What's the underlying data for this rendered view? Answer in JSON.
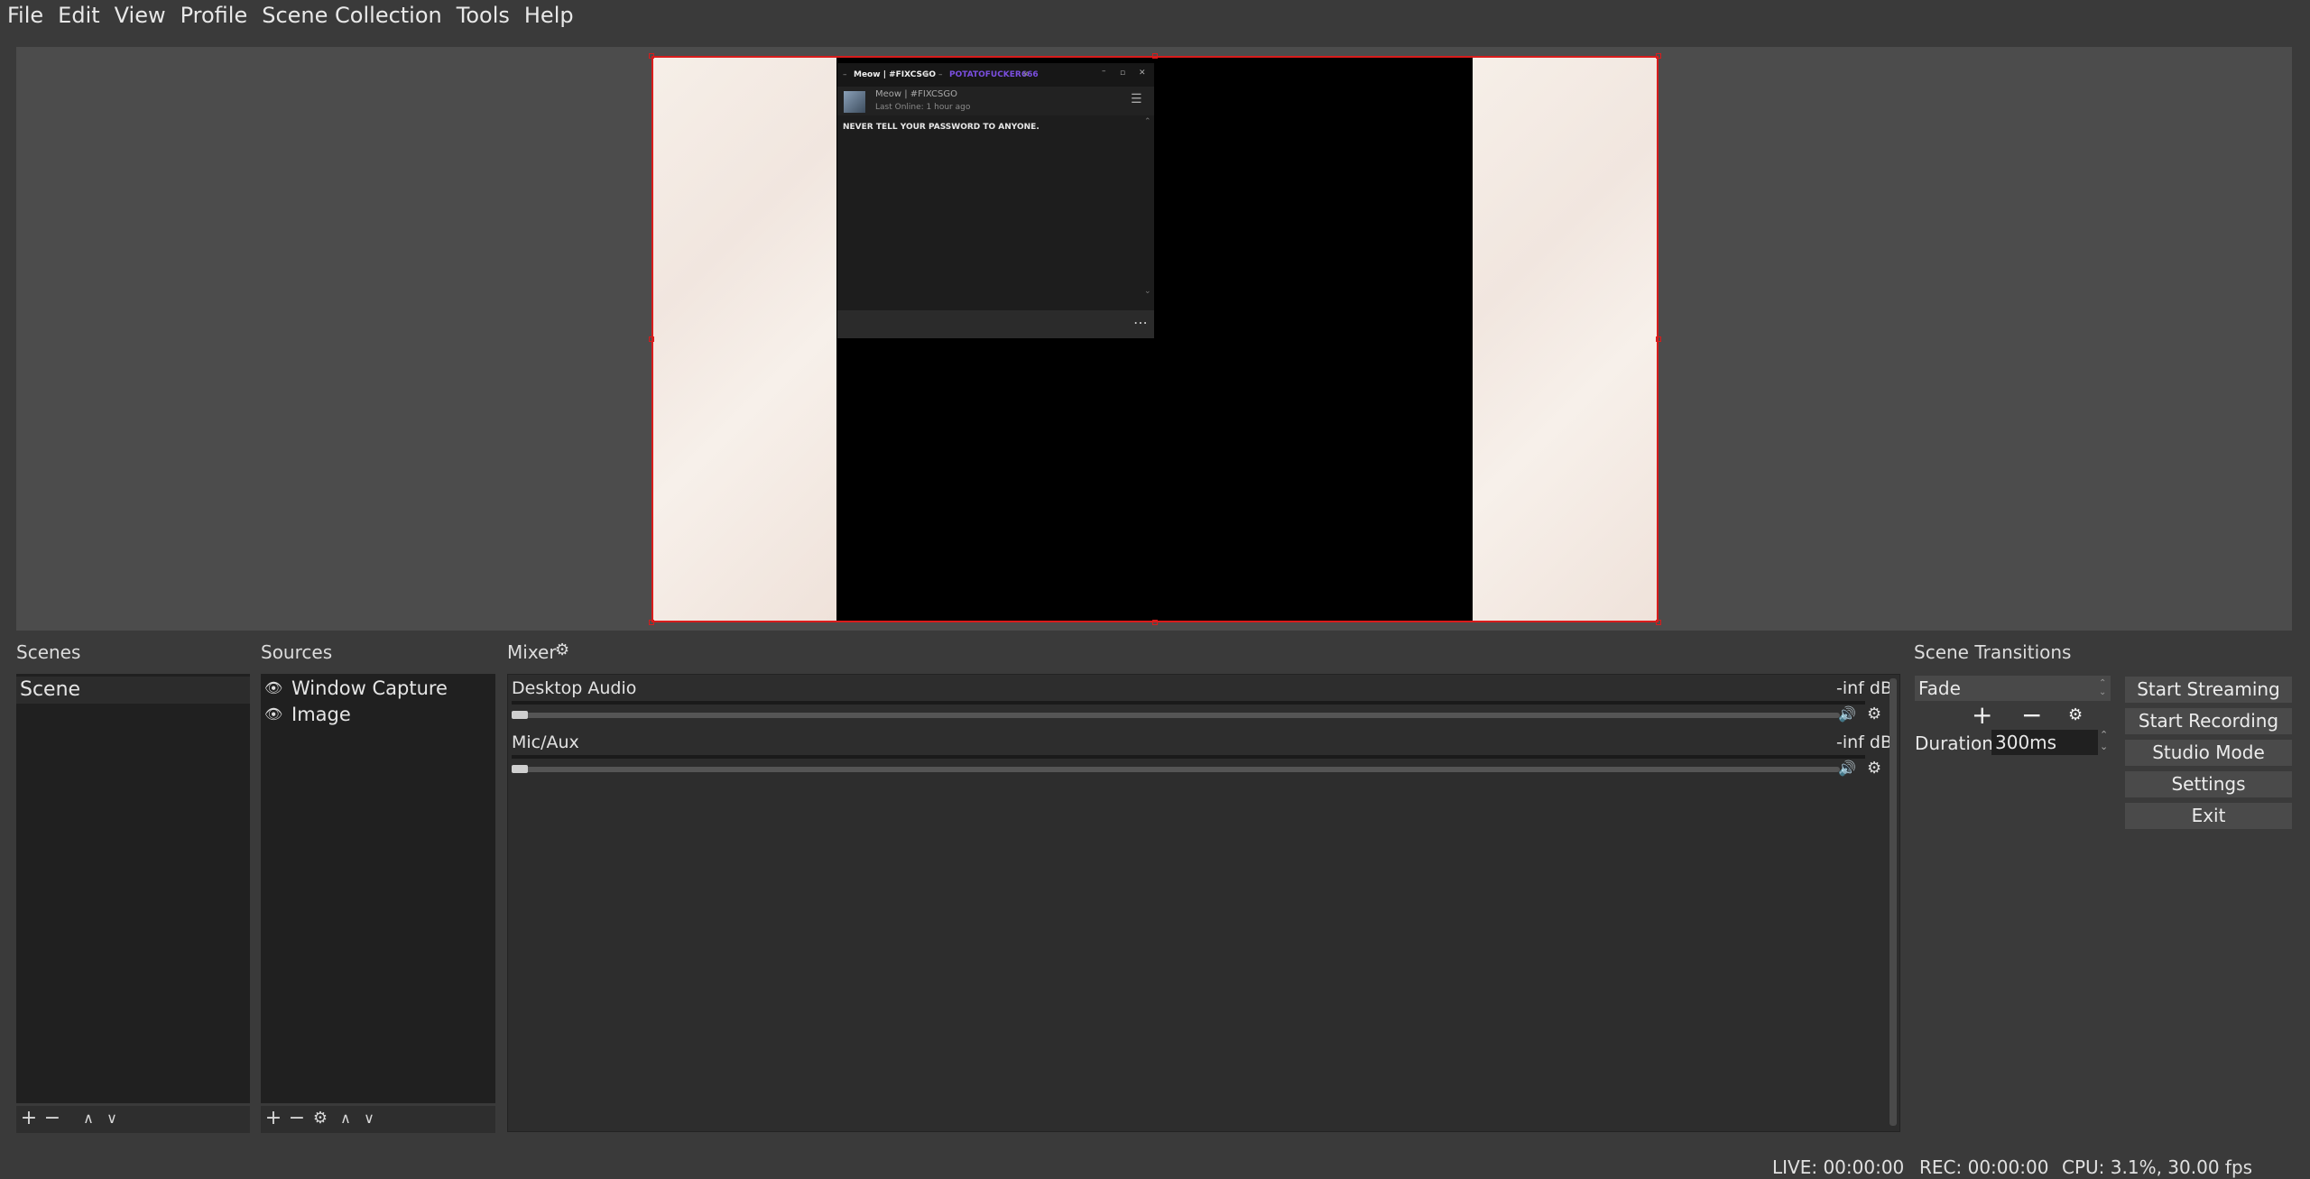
{
  "menu": [
    "File",
    "Edit",
    "View",
    "Profile",
    "Scene Collection",
    "Tools",
    "Help"
  ],
  "preview": {
    "chat": {
      "tab1": "Meow | #FIXCSGO",
      "tab2": "POTATOFUCKER666",
      "contact_name": "Meow | #FIXCSGO",
      "contact_status": "Last Online: 1 hour ago",
      "message": "NEVER TELL YOUR PASSWORD TO ANYONE.",
      "more": "⋯"
    }
  },
  "scenes": {
    "title": "Scenes",
    "items": [
      "Scene"
    ],
    "toolbar": {
      "add": "+",
      "remove": "−",
      "up": "∧",
      "down": "∨"
    }
  },
  "sources": {
    "title": "Sources",
    "items": [
      "Window Capture",
      "Image"
    ],
    "toolbar": {
      "add": "+",
      "remove": "−",
      "up": "∧",
      "down": "∨"
    }
  },
  "mixer": {
    "title": "Mixer",
    "channels": [
      {
        "name": "Desktop Audio",
        "level": "-inf dB",
        "volume": 0
      },
      {
        "name": "Mic/Aux",
        "level": "-inf dB",
        "volume": 0
      }
    ]
  },
  "transitions": {
    "title": "Scene Transitions",
    "selected": "Fade",
    "duration_label": "Duration",
    "duration_value": "300ms"
  },
  "controls": {
    "start_streaming": "Start Streaming",
    "start_recording": "Start Recording",
    "studio_mode": "Studio Mode",
    "settings": "Settings",
    "exit": "Exit"
  },
  "status": {
    "live": "LIVE: 00:00:00",
    "rec": "REC: 00:00:00",
    "cpu": "CPU: 3.1%, 30.00 fps"
  },
  "colors": {
    "selection": "#d81c1c",
    "tab2_color": "#7b4fe0"
  }
}
